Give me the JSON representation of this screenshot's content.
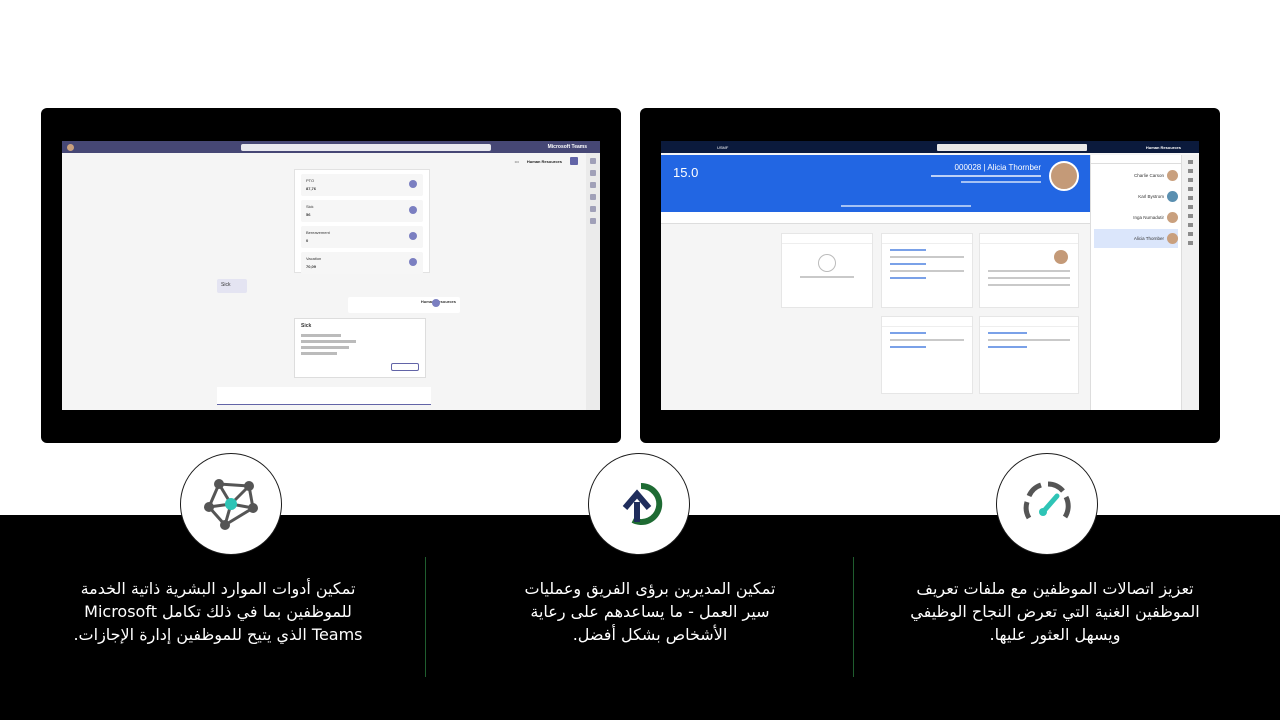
{
  "captions": {
    "left": "تمكين أدوات الموارد البشرية ذاتية الخدمة للموظفين بما في ذلك تكامل Microsoft Teams الذي يتيح للموظفين إدارة الإجازات.",
    "middle": "تمكين المديرين برؤى الفريق وعمليات سير العمل - ما يساعدهم على رعاية الأشخاص بشكل أفضل.",
    "right": "تعزيز اتصالات الموظفين مع ملفات تعريف الموظفين الغنية التي تعرض النجاح الوظيفي ويسهل العثور عليها."
  },
  "icons": {
    "left": "network-hub-icon",
    "middle": "cycle-arrow-icon",
    "right": "speedometer-gauge-icon"
  },
  "teams_screen": {
    "app_title": "Microsoft Teams",
    "hr_app_title": "Human Resources",
    "leave_items": [
      {
        "label": "PTO",
        "value": "87,76"
      },
      {
        "label": "Sick",
        "value": "56"
      },
      {
        "label": "Bereavement",
        "value": "0"
      },
      {
        "label": "Vacation",
        "value": "70,09"
      }
    ],
    "sick_card_title": "Sick",
    "bot_name": "Human Resources",
    "chat_short": "Sick"
  },
  "d365_screen": {
    "app_title": "Human Resources",
    "company": "USMF",
    "employee_id": "000028",
    "employee_name": "Alicia Thornber",
    "years_value": "15.0",
    "people": [
      {
        "name": "Charlie Carson",
        "selected": false
      },
      {
        "name": "Karl Bystrom",
        "selected": false
      },
      {
        "name": "Inga Numadutir",
        "selected": false
      },
      {
        "name": "Alicia Thornber",
        "selected": true
      }
    ]
  },
  "colors": {
    "teams_brand": "#464775",
    "d365_banner": "#2266e3",
    "accent_teal": "#2ec4b6",
    "accent_green": "#1e6b33",
    "accent_navy": "#1f2d5c"
  }
}
